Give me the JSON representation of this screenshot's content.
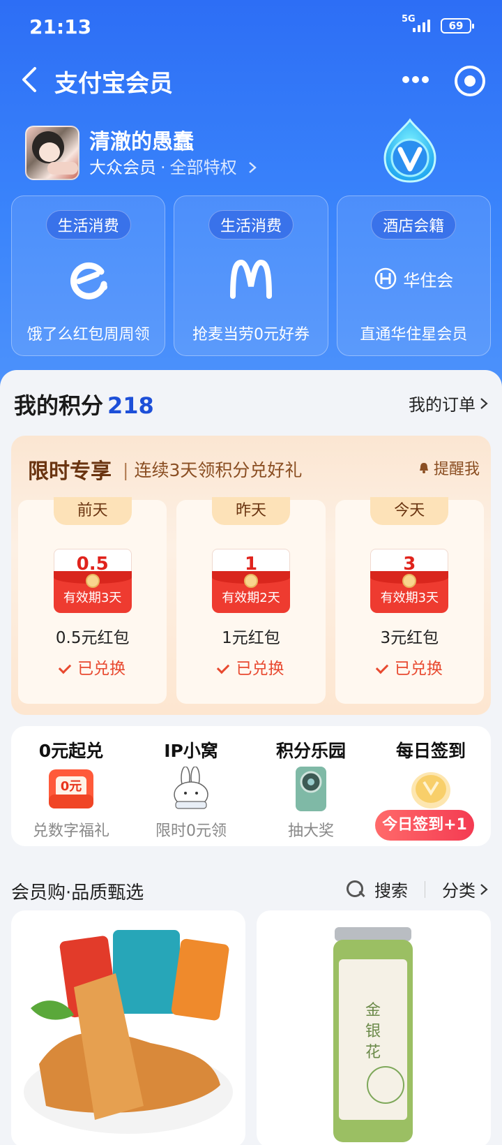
{
  "status_bar": {
    "time": "21:13",
    "network": "5G",
    "battery": "69"
  },
  "nav": {
    "title": "支付宝会员"
  },
  "profile": {
    "name": "清澈的愚蠢",
    "level": "大众会员",
    "separator": "·",
    "rights": "全部特权"
  },
  "benefits": [
    {
      "tag": "生活消费",
      "logo": "eleme-logo",
      "desc": "饿了么红包周周领"
    },
    {
      "tag": "生活消费",
      "logo": "mcdonalds-logo",
      "logo_text": "M",
      "desc": "抢麦当劳0元好券"
    },
    {
      "tag": "酒店会籍",
      "logo": "huazhu-logo",
      "logo_text": "华住会",
      "desc": "直通华住星会员"
    }
  ],
  "points": {
    "label": "我的积分",
    "value": "218",
    "orders_label": "我的订单"
  },
  "limited": {
    "title": "限时专享",
    "subtitle": "连续3天领积分兑好礼",
    "remind": "提醒我",
    "days": [
      {
        "tag": "前天",
        "amount": "0.5",
        "validity": "有效期3天",
        "prize": "0.5元红包",
        "status": "已兑换"
      },
      {
        "tag": "昨天",
        "amount": "1",
        "validity": "有效期2天",
        "prize": "1元红包",
        "status": "已兑换"
      },
      {
        "tag": "今天",
        "amount": "3",
        "validity": "有效期3天",
        "prize": "3元红包",
        "status": "已兑换"
      }
    ]
  },
  "quick": [
    {
      "title": "0元起兑",
      "sub": "兑数字福礼",
      "icon": "zero-coupon-icon",
      "icon_text": "0元"
    },
    {
      "title": "IP小窝",
      "sub": "限时0元领",
      "icon": "rabbit-icon"
    },
    {
      "title": "积分乐园",
      "sub": "抽大奖",
      "icon": "phone-icon"
    },
    {
      "title": "每日签到",
      "sub": "",
      "icon": "coin-icon",
      "pill": "今日签到+1"
    }
  ],
  "shop": {
    "title": "会员购·品质甄选",
    "search": "搜索",
    "category": "分类"
  },
  "products": [
    {
      "image": "spicy-tofu-snack-image"
    },
    {
      "image": "honeysuckle-tea-jar-image"
    }
  ],
  "colors": {
    "hero": "#3a84fb",
    "accent": "#1d4fd8",
    "red": "#ee3b30",
    "orange_text": "#e8492f"
  }
}
